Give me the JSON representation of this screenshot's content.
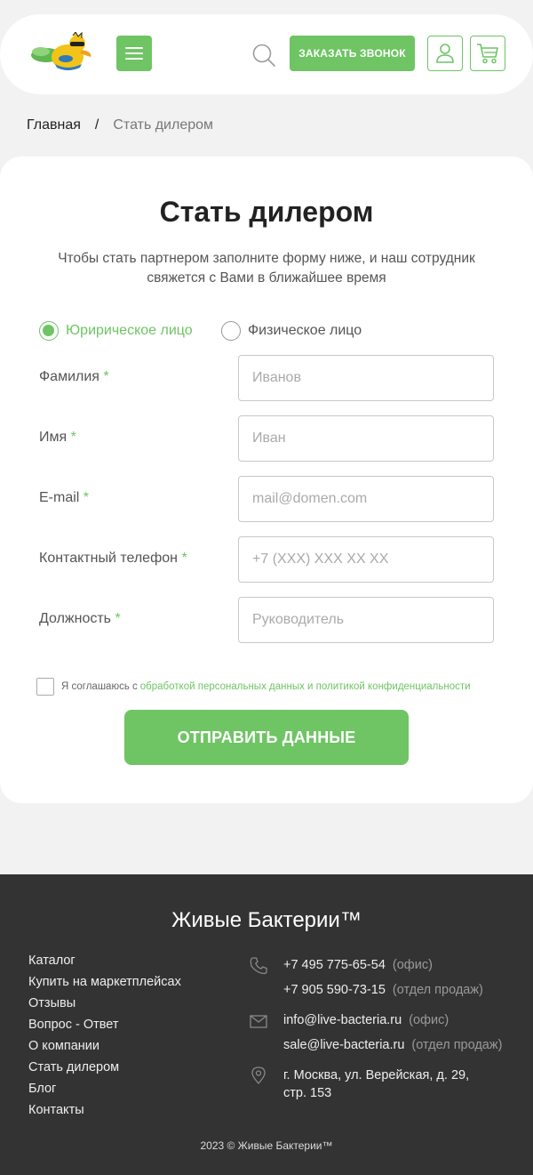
{
  "header": {
    "callback_label": "ЗАКАЗАТЬ ЗВОНОК",
    "colors": {
      "accent": "#6fc464",
      "footer_bg": "#333333",
      "page_bg": "#f2f2f2"
    },
    "icons": [
      "logo-mascot",
      "menu-icon",
      "search-icon",
      "user-icon",
      "cart-icon"
    ]
  },
  "breadcrumb": {
    "home": "Главная",
    "separator": "/",
    "current": "Стать дилером"
  },
  "form": {
    "title": "Стать дилером",
    "subtitle": "Чтобы стать партнером заполните форму ниже, и наш сотрудник свяжется с Вами в ближайшее время",
    "radio_options": [
      {
        "label": "Юририческое лицо",
        "checked": true
      },
      {
        "label": "Физическое лицо",
        "checked": false
      }
    ],
    "required_mark": "*",
    "fields": [
      {
        "label": "Фамилия",
        "placeholder": "Иванов"
      },
      {
        "label": "Имя",
        "placeholder": "Иван"
      },
      {
        "label": "E-mail",
        "placeholder": "mail@domen.com"
      },
      {
        "label": "Контактный телефон",
        "placeholder": "+7 (XXX) XXX XX XX"
      },
      {
        "label": "Должность",
        "placeholder": "Руководитель"
      }
    ],
    "agree_text": "Я соглашаюсь с",
    "agree_link": "обработкой персональных данных и политикой конфиденциальности",
    "submit_label": "ОТПРАВИТЬ ДАННЫЕ"
  },
  "footer": {
    "brand": "Живые Бактерии™",
    "nav": [
      "Каталог",
      "Купить на маркетплейсах",
      "Отзывы",
      "Вопрос - Ответ",
      "О компании",
      "Стать дилером",
      "Блог",
      "Контакты"
    ],
    "phones": [
      {
        "value": "+7 495 775-65-54",
        "note": "(офис)"
      },
      {
        "value": "+7 905 590-73-15",
        "note": "(отдел продаж)"
      }
    ],
    "emails": [
      {
        "value": "info@live-bacteria.ru",
        "note": "(офис)"
      },
      {
        "value": "sale@live-bacteria.ru",
        "note": "(отдел продаж)"
      }
    ],
    "address_line1": "г. Москва, ул. Верейская, д. 29,",
    "address_line2": "стр. 153",
    "copyright": "2023 © Живые Бактерии™"
  }
}
